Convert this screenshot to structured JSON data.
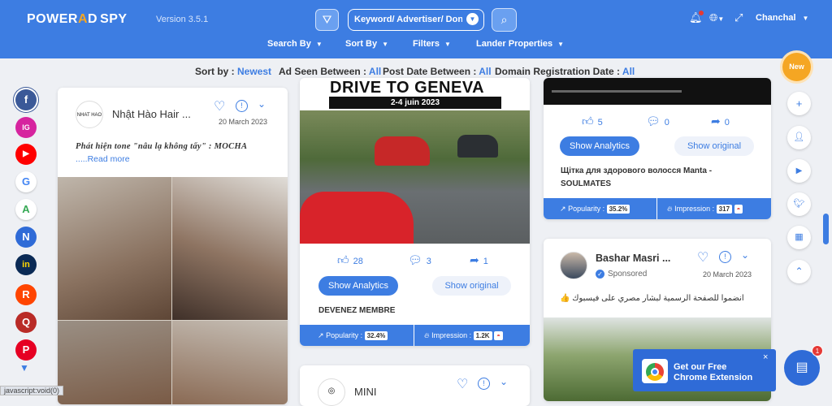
{
  "header": {
    "logo_a": "POWER",
    "logo_o": "A",
    "logo_b": "D",
    "logo_c": "SPY",
    "version": "Version 3.5.1",
    "search_placeholder": "Keyword/ Advertiser/ Don",
    "user": "Chanchal"
  },
  "menu": [
    "Search By",
    "Sort By",
    "Filters",
    "Lander Properties"
  ],
  "sortbar": {
    "sort_label": "Sort by :",
    "sort_value": "Newest",
    "seen_label": "Ad Seen Between :",
    "seen_value": "All",
    "post_label": "Post Date Between :",
    "post_value": "All",
    "domain_label": "Domain Registration Date :",
    "domain_value": "All"
  },
  "social": [
    "f",
    "IG",
    "▶",
    "G",
    "A",
    "N",
    "in",
    "R",
    "Q",
    "P"
  ],
  "card1": {
    "advertiser": "Nhật Hào Hair ...",
    "date": "20 March 2023",
    "avatar_text": "NHAT HAO",
    "text": "Phát hiện tone \"nâu lạ không tẩy\" : MOCHA",
    "read_more": ".....Read more"
  },
  "card2": {
    "banner_title": "DRIVE TO GENEVA",
    "banner_date": "2-4 juin 2023",
    "likes": "28",
    "comments": "3",
    "shares": "1",
    "analytics": "Show Analytics",
    "original": "Show original",
    "cta": "DEVENEZ MEMBRE",
    "popularity_label": "Popularity :",
    "popularity": "32.4%",
    "impression_label": "Impression :",
    "impression": "1.2K"
  },
  "card3": {
    "likes": "5",
    "comments": "0",
    "shares": "0",
    "analytics": "Show Analytics",
    "original": "Show original",
    "text1": "Щітка для здорового волосся Manta -",
    "text2": "SOULMATES",
    "popularity_label": "Popularity :",
    "popularity": "35.2%",
    "impression_label": "Impression :",
    "impression": "317"
  },
  "card4": {
    "advertiser": "Bashar Masri ...",
    "sponsored": "Sponsored",
    "date": "20 March 2023",
    "text": "انضموا للصفحة الرسمية لبشار مصري على فيسبوك 👍"
  },
  "card5": {
    "advertiser": "MINI"
  },
  "right": {
    "new": "New",
    "chat_badge": "1"
  },
  "extension": {
    "line1": "Get our Free",
    "line2": "Chrome Extension",
    "close": "×"
  },
  "statusbar": "javascript:void(0)"
}
